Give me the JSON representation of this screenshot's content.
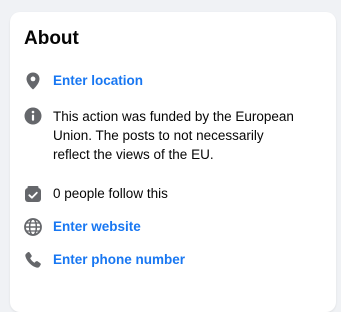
{
  "about": {
    "title": "About",
    "location_link": "Enter location",
    "description": "This action was funded by the European Union. The posts to not necessarily reflect the views of the EU.",
    "followers_text": "0 people follow this",
    "website_link": "Enter website",
    "phone_link": "Enter phone number"
  },
  "icons": {
    "location": "location-pin-icon",
    "info": "info-icon",
    "followers": "followers-check-icon",
    "website": "globe-icon",
    "phone": "phone-icon"
  },
  "colors": {
    "link": "#1877f2",
    "icon": "#65676b",
    "text": "#050505",
    "background": "#f0f2f5",
    "card": "#ffffff"
  }
}
